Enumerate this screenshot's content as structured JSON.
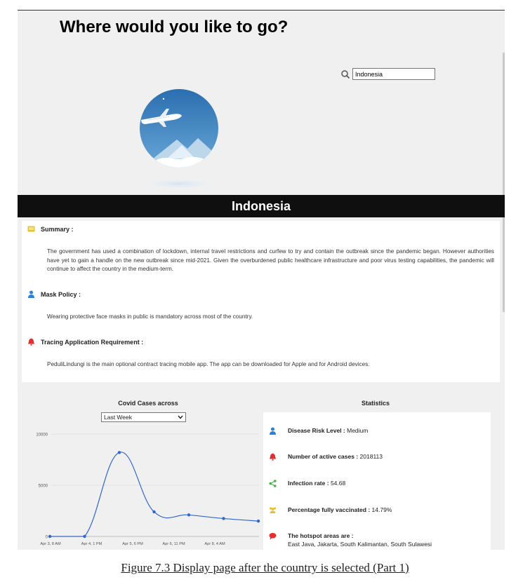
{
  "page": {
    "title": "Where would you like to go?",
    "search_value": "Indonesia",
    "country_name": "Indonesia"
  },
  "info": {
    "summary_label": "Summary :",
    "summary_text": "The government has used a combination of lockdown, internal travel restrictions and curfew to try and contain the outbreak since the pandemic began. However authorities have yet to gain a handle on the new outbreak since mid-2021. Given the overburdened public healthcare infrastructure and poor virus testing capabilities, the pandemic will continue to affect the country in the medium-term.",
    "mask_label": "Mask Policy :",
    "mask_text": "Wearing protective face masks in public is mandatory across most of the country.",
    "tracing_label": "Tracing Application Requirement :",
    "tracing_text": "PeduliLindungi is the main optional contract tracing mobile app. The app can be downloaded for Apple and for Android devices."
  },
  "chart_controls": {
    "selected_range": "Last Week"
  },
  "chart_data": {
    "type": "line",
    "title": "Covid Cases across",
    "x": [
      "Apr 3, 8 AM",
      "Apr 4, 1 PM",
      "Apr 5, 6 PM",
      "Apr 6, 11 PM",
      "Apr 8, 4 AM"
    ],
    "points": [
      {
        "x": "Apr 3, 8 AM",
        "y": 0
      },
      {
        "x": "Apr 4, 1 PM",
        "y": 0
      },
      {
        "x": "Apr 5",
        "y": 8200
      },
      {
        "x": "Apr 6",
        "y": 2400
      },
      {
        "x": "Apr 7",
        "y": 2100
      },
      {
        "x": "Apr 8",
        "y": 1750
      },
      {
        "x": "Apr 9",
        "y": 1500
      }
    ],
    "y_ticks": [
      0,
      5000,
      10000
    ],
    "ylim": [
      0,
      10000
    ],
    "grid": true,
    "line_color": "#3366cc"
  },
  "stats": {
    "title": "Statistics",
    "risk_label": "Disease Risk Level :",
    "risk_value": "Medium",
    "active_label": "Number of active cases :",
    "active_value": "2018113",
    "infection_label": "Infection rate :",
    "infection_value": "54.68",
    "vaccinated_label": "Percentage fully vaccinated :",
    "vaccinated_value": "14.79%",
    "hotspot_label": "The hotspot areas are :",
    "hotspot_value": "East Java, Jakarta, South Kalimantan, South Sulawesi"
  },
  "caption": "Figure 7.3 Display page after the country is selected (Part 1)",
  "colors": {
    "banner": "#0f0f0f",
    "summary_icon": "#e6c22e",
    "mask_icon": "#2f7fd6",
    "tracing_icon": "#e03030",
    "share_icon": "#4caf50",
    "group_icon": "#e6c22e",
    "comment_icon": "#e03030"
  }
}
